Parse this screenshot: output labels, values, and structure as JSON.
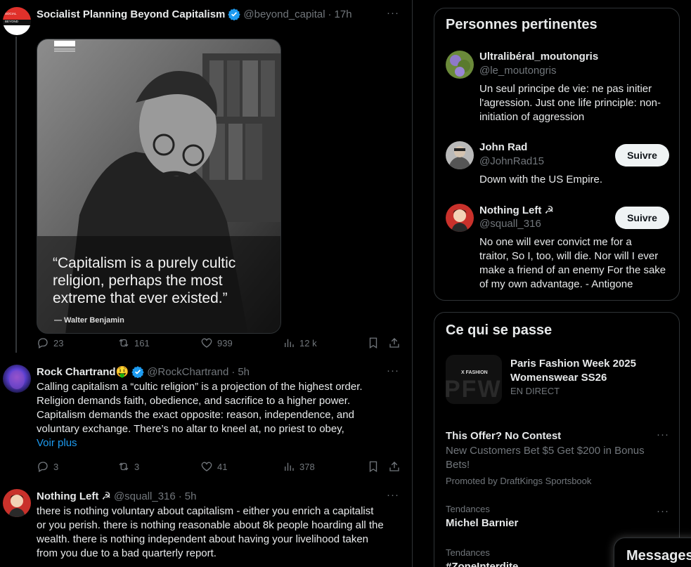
{
  "tweets": [
    {
      "name": "Socialist Planning Beyond Capitalism",
      "handle": "@beyond_capital",
      "sep": "·",
      "time": "17h",
      "avatar_text": "SOCIALIST PLANNING BEYOND CAPITALISM",
      "media": {
        "quote": "“Capitalism is a purely cultic\nreligion, perhaps the most\nextreme that ever existed.”",
        "author": "— Walter Benjamin"
      },
      "stats": {
        "replies": "23",
        "reposts": "161",
        "likes": "939",
        "views": "12 k"
      }
    },
    {
      "name": "Rock Chartrand🤑",
      "handle": "@RockChartrand",
      "sep": "·",
      "time": "5h",
      "text": "Calling capitalism a “cultic religion” is a projection of the highest order.\nReligion demands faith, obedience, and sacrifice to a higher power.\nCapitalism demands the exact opposite: reason, independence, and\nvoluntary exchange. There’s no altar to kneel at, no priest to obey,",
      "show_more": "Voir plus",
      "stats": {
        "replies": "3",
        "reposts": "3",
        "likes": "41",
        "views": "378"
      }
    },
    {
      "name": "Nothing Left ☭",
      "handle": "@squall_316",
      "sep": "·",
      "time": "5h",
      "text": "there is nothing voluntary about capitalism - either you enrich a capitalist\nor you perish. there is nothing reasonable about 8k people hoarding all the\nwealth. there is nothing independent about having your livelihood taken\nfrom you due to a bad quarterly report."
    }
  ],
  "people": {
    "title": "Personnes pertinentes",
    "items": [
      {
        "name": "Ultralibéral_moutongris",
        "handle": "@le_moutongris",
        "bio": "Un seul principe de vie: ne pas initier\nl'agression. Just one life principle: non-\ninitiation of aggression"
      },
      {
        "name": "John Rad",
        "handle": "@JohnRad15",
        "bio": "Down with the US Empire.",
        "button": "Suivre"
      },
      {
        "name": "Nothing Left ☭",
        "handle": "@squall_316",
        "bio": "No one will ever convict me for a\ntraitor, So I, too, will die. Nor will I ever\nmake a friend of an enemy For the sake\nof my own advantage. - Antigone",
        "button": "Suivre"
      }
    ]
  },
  "happening": {
    "title": "Ce qui se passe",
    "event": {
      "title": "Paris Fashion Week 2025\nWomenswear SS26",
      "status": "EN DIRECT",
      "thumb_label": "X FASHION",
      "thumb_big": "PFW"
    },
    "promo": {
      "title": "This Offer? No Contest",
      "body": "New Customers Bet $5 Get $200 in Bonus\nBets!",
      "by": "Promoted by DraftKings Sportsbook"
    },
    "trends": [
      {
        "category": "Tendances",
        "title": "Michel Barnier"
      },
      {
        "category": "Tendances",
        "title": "#ZoneInterdite"
      }
    ]
  },
  "messages": {
    "label": "Messages"
  },
  "more_glyph": "···",
  "colors": {
    "accent": "#1d9bf0",
    "muted": "#71767b",
    "text": "#e7e9ea",
    "border": "#2f3336"
  },
  "icons": [
    "reply-icon",
    "repost-icon",
    "like-icon",
    "views-icon",
    "bookmark-icon",
    "share-icon",
    "verified-icon",
    "more-icon"
  ]
}
